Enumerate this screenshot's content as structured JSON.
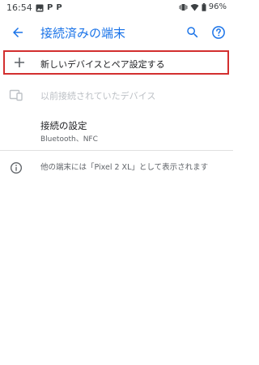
{
  "status_bar": {
    "time": "16:54",
    "left_icons": [
      "image-icon",
      "p-icon",
      "p-icon"
    ],
    "p_label": "P",
    "battery_percent": "96%"
  },
  "app_bar": {
    "title": "接続済みの端末",
    "back_icon": "back-arrow-icon",
    "search_icon": "search-icon",
    "help_icon": "help-icon"
  },
  "items": {
    "pair_new": {
      "label": "新しいデバイスとペア設定する",
      "icon": "plus-icon"
    },
    "previously_connected": {
      "label": "以前接続されていたデバイス",
      "icon": "devices-icon"
    },
    "connection_prefs": {
      "label": "接続の設定",
      "summary": "Bluetooth、NFC"
    },
    "info": {
      "text": "他の端末には「Pixel 2 XL」として表示されます",
      "icon": "info-icon"
    }
  },
  "colors": {
    "accent": "#1a73e8",
    "highlight_border": "#d32f2f",
    "disabled_text": "#bdc1c6"
  }
}
